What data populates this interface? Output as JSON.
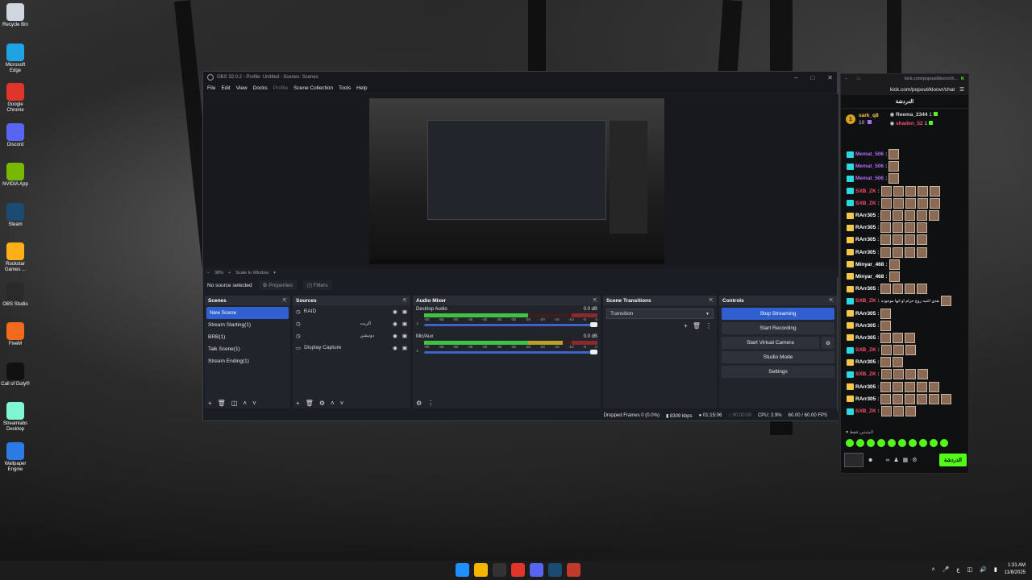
{
  "desktop": {
    "icons": [
      {
        "label": "Recycle Bin",
        "icon": "recycle-bin-icon",
        "color": "#cfd6de"
      },
      {
        "label": "Microsoft Edge",
        "icon": "edge-icon",
        "color": "#1fa3e2"
      },
      {
        "label": "Google Chrome",
        "icon": "chrome-icon",
        "color": "#e0352b"
      },
      {
        "label": "Discord",
        "icon": "discord-icon",
        "color": "#5865f2"
      },
      {
        "label": "NVIDIA App",
        "icon": "nvidia-icon",
        "color": "#76b900"
      },
      {
        "label": "Steam",
        "icon": "steam-icon",
        "color": "#1b4b72"
      },
      {
        "label": "Rockstar Games ...",
        "icon": "rockstar-icon",
        "color": "#fcaf17"
      },
      {
        "label": "OBS Studio",
        "icon": "obs-icon",
        "color": "#2a2a2a"
      },
      {
        "label": "FiveM",
        "icon": "fivem-icon",
        "color": "#f26b1d"
      },
      {
        "label": "Call of Duty®",
        "icon": "cod-icon",
        "color": "#111111"
      },
      {
        "label": "Streamlabs Desktop",
        "icon": "streamlabs-icon",
        "color": "#80f5d2"
      },
      {
        "label": "Wallpaper Engine",
        "icon": "wallpaper-engine-icon",
        "color": "#2c7be5"
      }
    ]
  },
  "obs": {
    "title": "OBS 32.0.2 - Profile: Untitled - Scenes: Scenes",
    "menu": [
      "File",
      "Edit",
      "View",
      "Docks",
      "Profile",
      "Scene Collection",
      "Tools",
      "Help"
    ],
    "zoom": "38%",
    "scale_mode": "Scale to Window",
    "no_source": "No source selected",
    "properties_label": "Properties",
    "filters_label": "Filters",
    "scenes_title": "Scenes",
    "scenes": [
      "New Scene",
      "Stream Starting(1)",
      "BRB(1)",
      "Talk Scene(1)",
      "Stream Ending(1)"
    ],
    "selected_scene": "New Scene",
    "sources_title": "Sources",
    "sources": [
      {
        "name": "RAID",
        "icon": "browser-source-icon"
      },
      {
        "name": "الريت",
        "icon": "browser-source-icon"
      },
      {
        "name": "دونيشن",
        "icon": "browser-source-icon"
      },
      {
        "name": "Display Capture",
        "icon": "monitor-icon"
      }
    ],
    "mixer_title": "Audio Mixer",
    "channels": [
      {
        "name": "Desktop Audio",
        "db": "0.0 dB",
        "level": 0.6
      },
      {
        "name": "Mic/Aux",
        "db": "0.0 dB",
        "level": 0.8
      }
    ],
    "meter_scale": [
      "-60",
      "-55",
      "-50",
      "-45",
      "-40",
      "-35",
      "-30",
      "-25",
      "-20",
      "-15",
      "-10",
      "-5",
      "0"
    ],
    "transitions_title": "Scene Transitions",
    "transition": "Transition",
    "controls_title": "Controls",
    "controls": [
      "Stop Streaming",
      "Start Recording",
      "Start Virtual Camera",
      "Studio Mode",
      "Settings"
    ],
    "status": {
      "dropped": "Dropped Frames 0 (0.0%)",
      "bitrate": "8309 kbps",
      "stream_time": "01:15:06",
      "rec_time": "00:00:00",
      "cpu": "CPU: 2.9%",
      "fps": "60.00 / 60.00 FPS"
    }
  },
  "chat": {
    "url_title": "kick.com/popout/kloov/ch...",
    "url": "kick.com/popout/kloovr/chat",
    "header": "الدردشة",
    "leaders": {
      "first": {
        "name": "sark_q8",
        "rank": "1",
        "count": "10"
      },
      "second": {
        "name": "Reema_2344",
        "count": "1"
      },
      "third": {
        "name": "shaden_52",
        "count": "1"
      }
    },
    "messages": [
      {
        "user": "Memat_506",
        "color": "#b36bff",
        "emotes": 1
      },
      {
        "user": "Memat_506",
        "color": "#b36bff",
        "emotes": 1
      },
      {
        "user": "Memat_506",
        "color": "#b36bff",
        "emotes": 1
      },
      {
        "user": "SXB_ZK",
        "color": "#ff4d6d",
        "emotes": 5
      },
      {
        "user": "SXB_ZK",
        "color": "#ff4d6d",
        "emotes": 5
      },
      {
        "user": "RArr305",
        "color": "#ffffff",
        "emotes": 5
      },
      {
        "user": "RArr305",
        "color": "#ffffff",
        "emotes": 4
      },
      {
        "user": "RArr305",
        "color": "#ffffff",
        "emotes": 4
      },
      {
        "user": "RArr305",
        "color": "#ffffff",
        "emotes": 4
      },
      {
        "user": "Minyar_468",
        "color": "#ffffff",
        "emotes": 1
      },
      {
        "user": "Minyar_468",
        "color": "#ffffff",
        "emotes": 1
      },
      {
        "user": "RArr305",
        "color": "#ffffff",
        "emotes": 4
      },
      {
        "user": "SXB_ZK",
        "color": "#ff4d6d",
        "emotes": 1,
        "text": "هذي اغنيه زوج حرام او انها موجوده"
      },
      {
        "user": "RArr305",
        "color": "#ffffff",
        "emotes": 1
      },
      {
        "user": "RArr305",
        "color": "#ffffff",
        "emotes": 1
      },
      {
        "user": "RArr305",
        "color": "#ffffff",
        "emotes": 3
      },
      {
        "user": "SXB_ZK",
        "color": "#ff4d6d",
        "emotes": 3
      },
      {
        "user": "RArr305",
        "color": "#ffffff",
        "emotes": 2
      },
      {
        "user": "SXB_ZK",
        "color": "#ff4d6d",
        "emotes": 4
      },
      {
        "user": "RArr305",
        "color": "#ffffff",
        "emotes": 5
      },
      {
        "user": "RArr305",
        "color": "#ffffff",
        "emotes": 6
      },
      {
        "user": "SXB_ZK",
        "color": "#ff4d6d",
        "emotes": 3
      }
    ],
    "footer_note": "المثبتين فقط",
    "send_label": "الدردشة"
  },
  "taskbar": {
    "apps": [
      {
        "icon": "start-icon",
        "color": "#1e90ff"
      },
      {
        "icon": "file-explorer-icon",
        "color": "#f4b400"
      },
      {
        "icon": "obs-icon",
        "color": "#333333"
      },
      {
        "icon": "chrome-icon",
        "color": "#e0352b"
      },
      {
        "icon": "discord-icon",
        "color": "#5865f2"
      },
      {
        "icon": "steam-icon",
        "color": "#1b4b72"
      },
      {
        "icon": "rockstar-icon",
        "color": "#c0392b"
      }
    ],
    "lang": "ع",
    "time": "1:31 AM",
    "date": "11/8/2025"
  }
}
